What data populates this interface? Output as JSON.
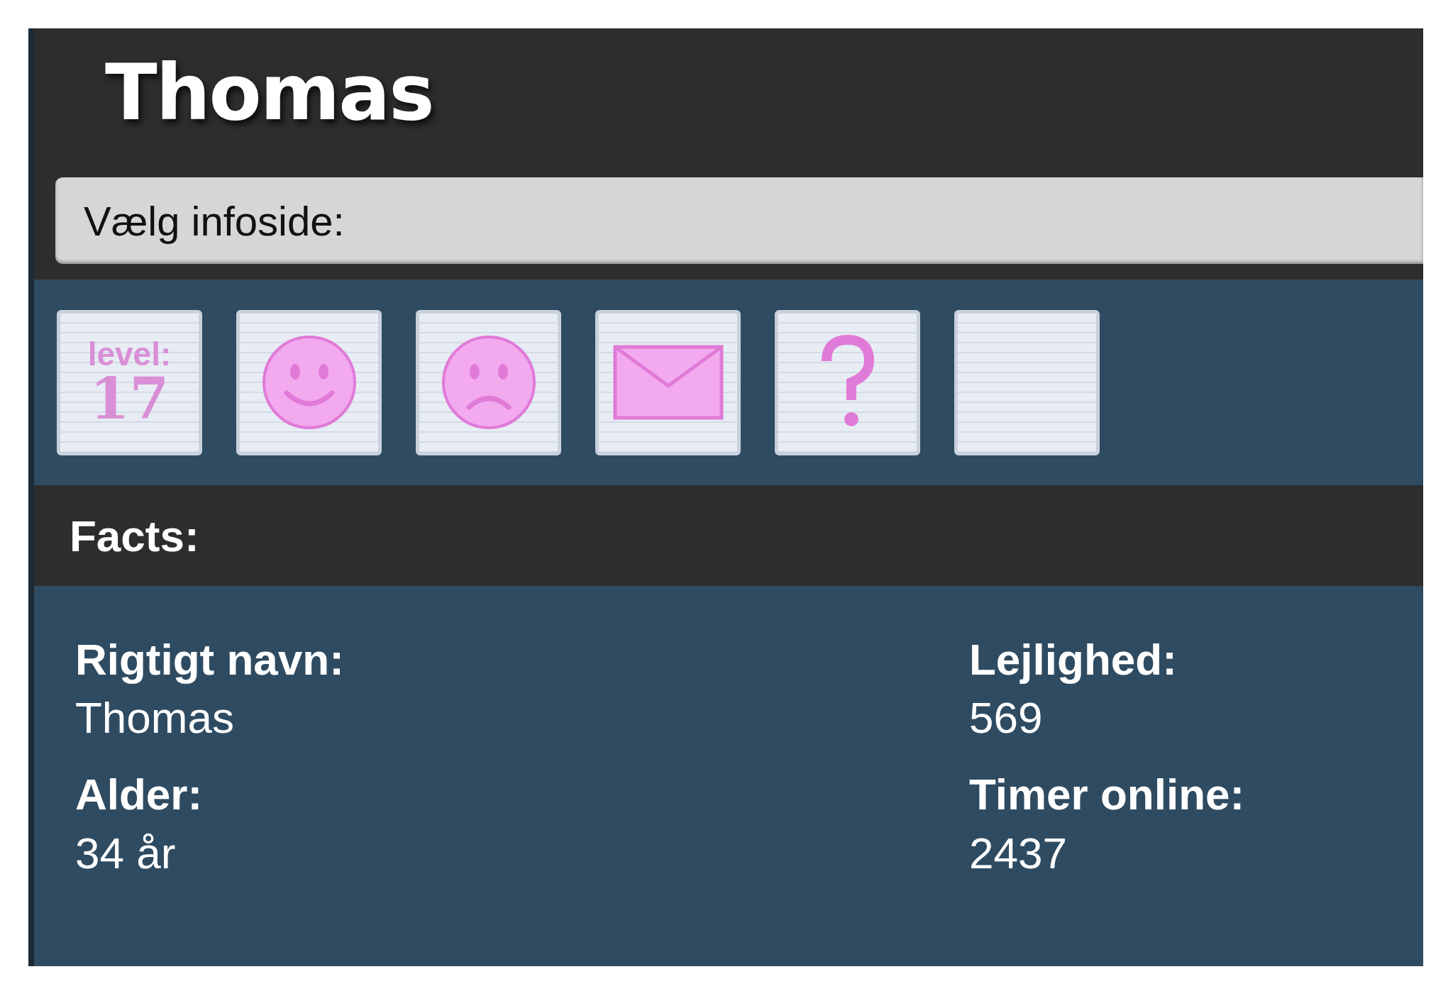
{
  "header": {
    "title": "Thomas"
  },
  "info_select": {
    "label": "Vælg infoside:"
  },
  "icon_tiles": [
    {
      "kind": "level",
      "caption": "level:",
      "value": "17"
    },
    {
      "kind": "happy"
    },
    {
      "kind": "sad"
    },
    {
      "kind": "mail"
    },
    {
      "kind": "question"
    },
    {
      "kind": "blank"
    }
  ],
  "facts": {
    "title": "Facts:",
    "items": [
      {
        "label": "Rigtigt navn:",
        "value": "Thomas"
      },
      {
        "label": "Lejlighed:",
        "value": "569"
      },
      {
        "label": "Alder:",
        "value": "34 år"
      },
      {
        "label": "Timer online:",
        "value": "2437"
      }
    ]
  }
}
